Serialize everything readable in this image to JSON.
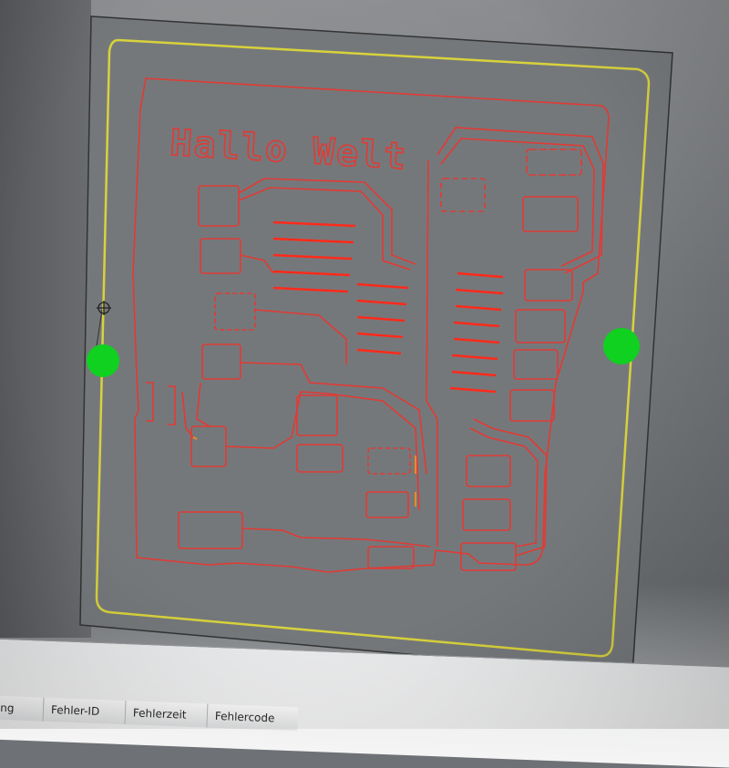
{
  "board": {
    "title_text": "Hallo Welt",
    "colors": {
      "trace": "#e23a34",
      "bright_trace": "#ff2a1a",
      "outline": "#d8d23c",
      "fiducial": "#10d020",
      "drill": "#f08a20"
    }
  },
  "error_table": {
    "columns": [
      "bung",
      "Fehler-ID",
      "Fehlerzeit",
      "Fehlercode"
    ]
  },
  "icons": {
    "crosshair": "crosshair-icon",
    "fiducial": "fiducial-marker-icon"
  }
}
